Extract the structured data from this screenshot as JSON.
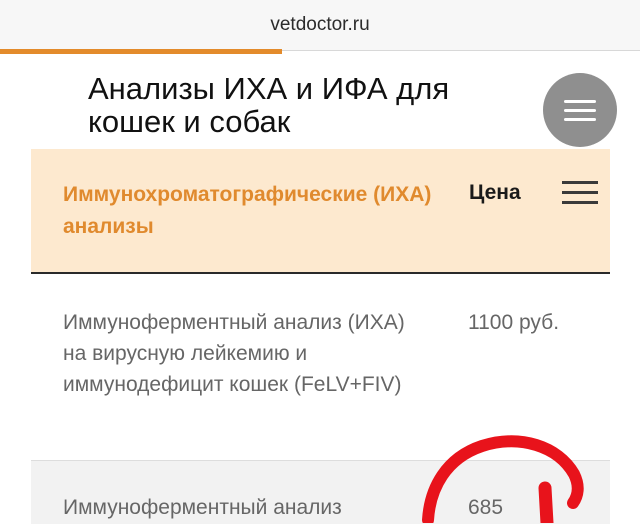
{
  "browser": {
    "url": "vetdoctor.ru",
    "load_progress": 0.44
  },
  "page": {
    "title": "Анализы ИХА и ИФА для кошек и собак"
  },
  "menu_fab": {
    "icon": "hamburger-icon",
    "color": "#8f8f8f"
  },
  "table": {
    "header": {
      "title": "Иммунохроматографические (ИХА) анализы",
      "price": "Цена",
      "menu_icon": "hamburger-icon"
    },
    "rows": [
      {
        "name": "Иммуноферментный анализ (ИХА) на вирусную лейкемию и иммунодефицит кошек (FeLV+FIV)",
        "price": "1100 руб."
      },
      {
        "name": "Иммуноферментный анализ",
        "price": "685"
      }
    ]
  },
  "colors": {
    "accent": "#e38b2b",
    "header_bg": "#fde9cf",
    "annotation": "#e8131b"
  }
}
